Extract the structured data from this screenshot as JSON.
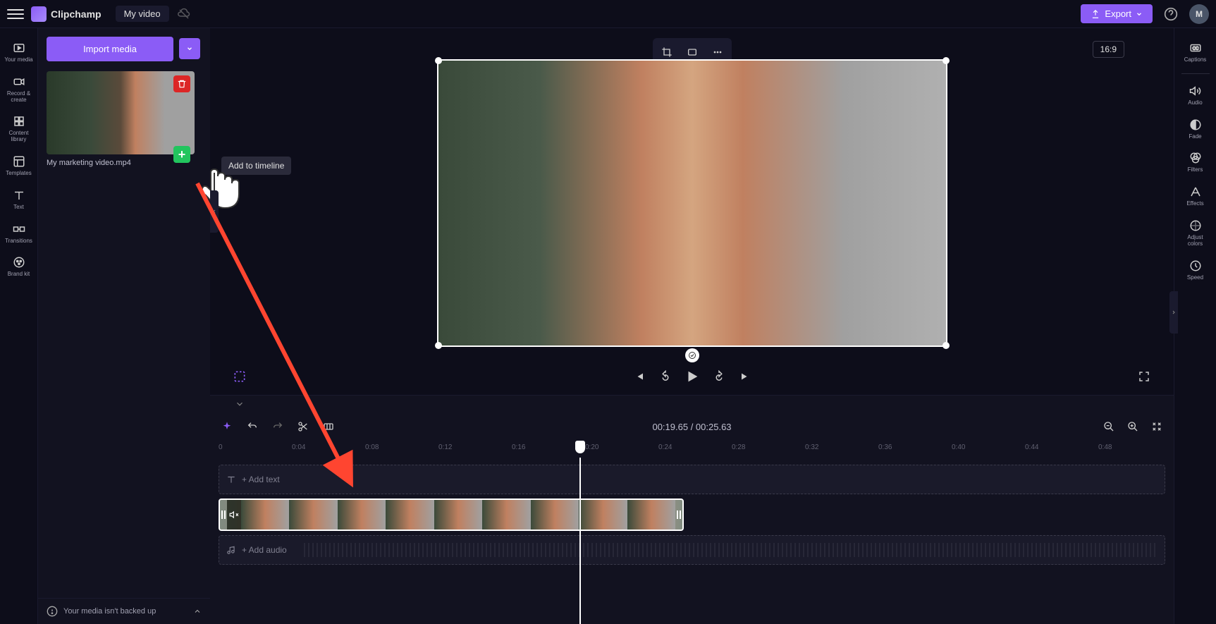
{
  "app": {
    "name": "Clipchamp",
    "project": "My video"
  },
  "topbar": {
    "export": "Export",
    "avatar_initial": "M",
    "aspect": "16:9"
  },
  "left_sidebar": {
    "items": [
      {
        "label": "Your media"
      },
      {
        "label": "Record & create"
      },
      {
        "label": "Content library"
      },
      {
        "label": "Templates"
      },
      {
        "label": "Text"
      },
      {
        "label": "Transitions"
      },
      {
        "label": "Brand kit"
      }
    ]
  },
  "media_panel": {
    "import": "Import media",
    "clip_name": "My marketing video.mp4",
    "tooltip": "Add to timeline",
    "backup_msg": "Your media isn't backed up"
  },
  "right_sidebar": {
    "items": [
      {
        "label": "Captions"
      },
      {
        "label": "Audio"
      },
      {
        "label": "Fade"
      },
      {
        "label": "Filters"
      },
      {
        "label": "Effects"
      },
      {
        "label": "Adjust colors"
      },
      {
        "label": "Speed"
      }
    ]
  },
  "timeline": {
    "current": "00:19.65",
    "total": "00:25.63",
    "ruler": [
      "0",
      "0:04",
      "0:08",
      "0:12",
      "0:16",
      "0:20",
      "0:24",
      "0:28",
      "0:32",
      "0:36",
      "0:40",
      "0:44",
      "0:48"
    ],
    "add_text": "+ Add text",
    "add_audio": "+ Add audio"
  }
}
